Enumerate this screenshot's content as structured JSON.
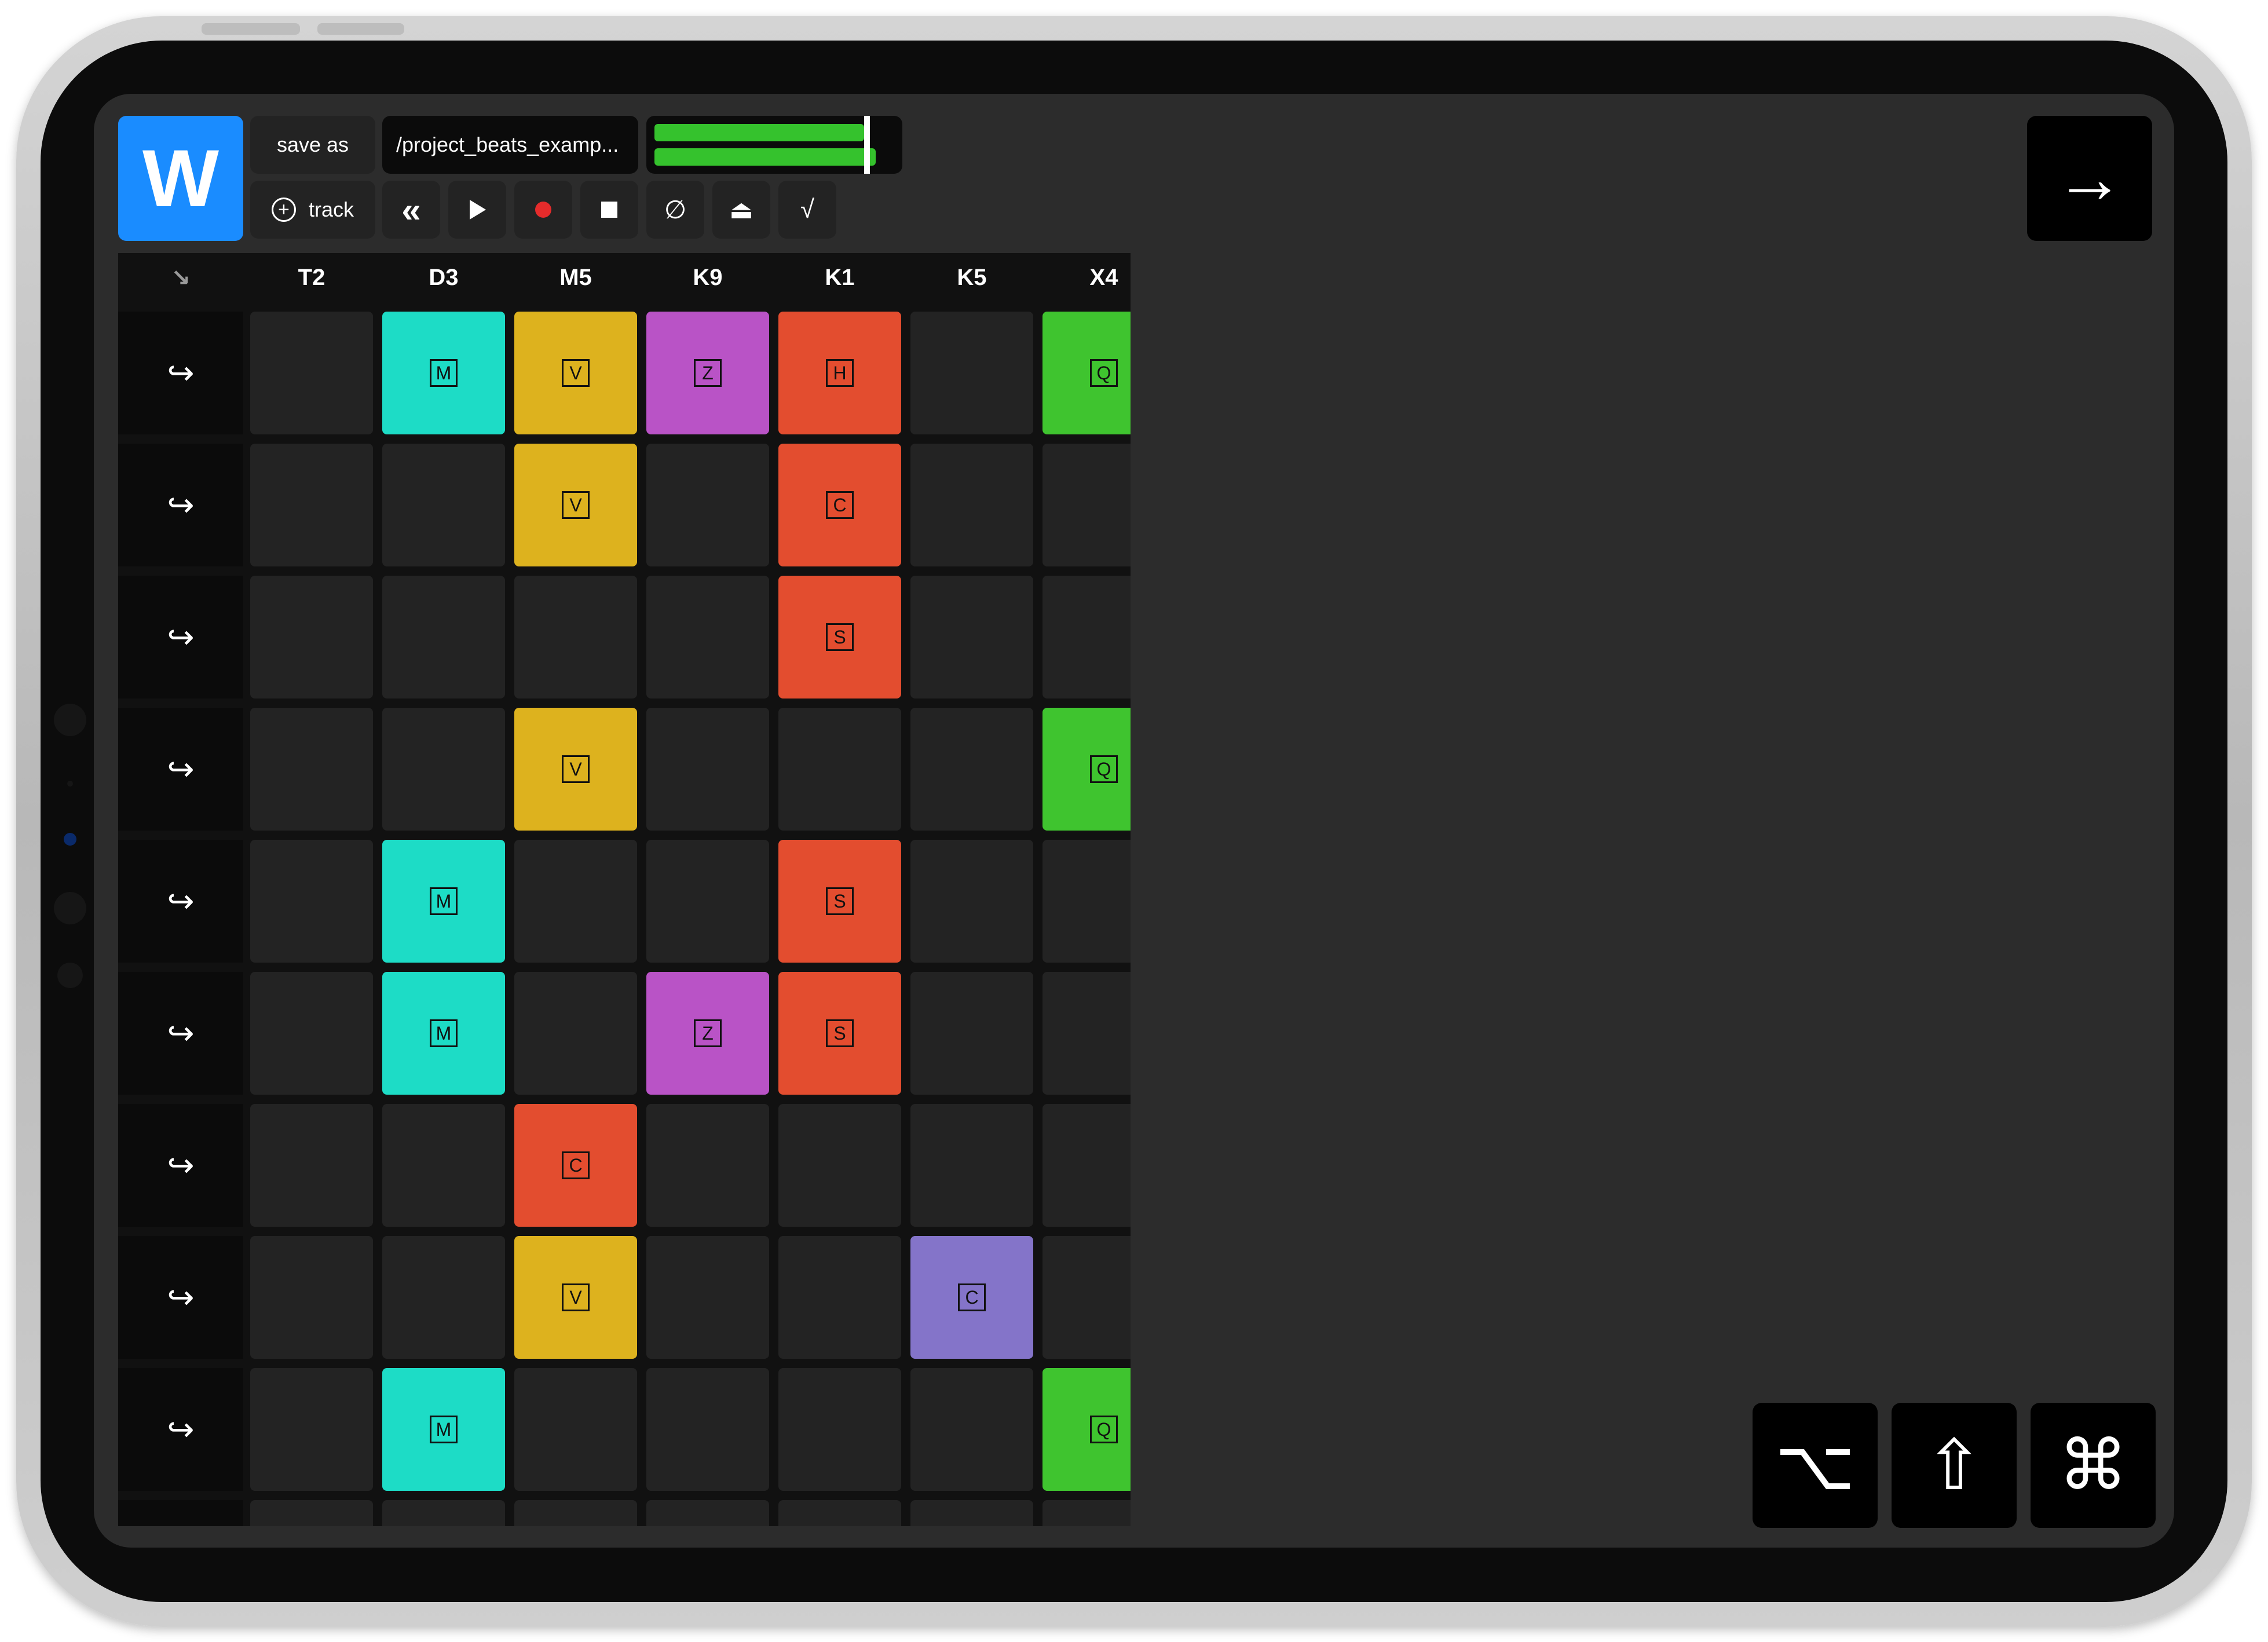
{
  "app": {
    "logo_letter": "W",
    "save_as_label": "save as",
    "path_text": "/project_beats_examp...",
    "add_track_label": "track",
    "meter": {
      "level_top": 0.92,
      "level_bottom": 0.97,
      "playhead": 0.92
    }
  },
  "transport": {
    "rewind": "«",
    "eject": "⏏",
    "null_symbol": "∅",
    "check": "√"
  },
  "grid": {
    "corner_icon": "↘",
    "row_icon": "↪",
    "columns": [
      "T2",
      "D3",
      "M5",
      "K9",
      "K1",
      "K5",
      "X4"
    ],
    "rows": [
      [
        "",
        "M",
        "V",
        "Z",
        "H",
        "",
        "Q"
      ],
      [
        "",
        "",
        "V",
        "",
        "C",
        "",
        ""
      ],
      [
        "",
        "",
        "",
        "",
        "S",
        "",
        ""
      ],
      [
        "",
        "",
        "V",
        "",
        "",
        "",
        "Q"
      ],
      [
        "",
        "M",
        "",
        "",
        "S",
        "",
        ""
      ],
      [
        "",
        "M",
        "",
        "Z",
        "S",
        "",
        ""
      ],
      [
        "",
        "",
        "C",
        "",
        "",
        "",
        ""
      ],
      [
        "",
        "",
        "V",
        "",
        "",
        "C",
        ""
      ],
      [
        "",
        "M",
        "",
        "",
        "",
        "",
        "Q"
      ],
      [
        "",
        "",
        "",
        "",
        "",
        "",
        ""
      ]
    ],
    "colors": {
      "M": "#1ddcc6",
      "V": "#ddb21e",
      "Z": "#b953c6",
      "H": "#e34d2f",
      "C": "#e34d2f",
      "S": "#e34d2f",
      "Q": "#3fc42f",
      "C_purple": "#8474c9"
    },
    "special_colors": {
      "7-5": "#8474c9"
    }
  },
  "keys": {
    "next": "→",
    "option": "⌥",
    "shift": "⇧",
    "command": "⌘"
  },
  "theme": {
    "accent": "#1a8cff",
    "background": "#2c2c2c",
    "cell": "#232323"
  }
}
